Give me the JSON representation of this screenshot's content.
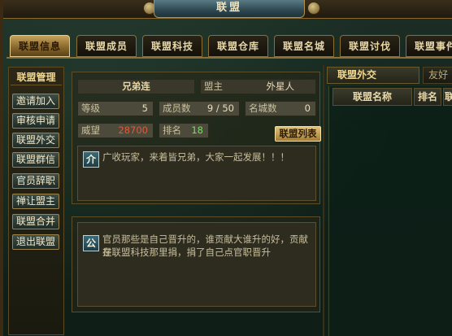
{
  "window": {
    "title": "联盟"
  },
  "tabs": [
    {
      "label": "联盟信息",
      "active": true
    },
    {
      "label": "联盟成员"
    },
    {
      "label": "联盟科技"
    },
    {
      "label": "联盟仓库"
    },
    {
      "label": "联盟名城"
    },
    {
      "label": "联盟讨伐"
    },
    {
      "label": "联盟事件"
    }
  ],
  "sidebar": {
    "title": "联盟管理",
    "buttons": [
      "邀请加入",
      "审核申请",
      "联盟外交",
      "联盟群信",
      "官员辞职",
      "禅让盟主",
      "联盟合并",
      "退出联盟"
    ]
  },
  "info": {
    "alliance_name": "兄弟连",
    "leader_label": "盟主",
    "leader_name": "外星人",
    "level_label": "等级",
    "level_value": "5",
    "members_label": "成员数",
    "members_value": "9 / 50",
    "cities_label": "名城数",
    "cities_value": "0",
    "prestige_label": "威望",
    "prestige_value": "28700",
    "rank_label": "排名",
    "rank_value": "18",
    "list_button": "联盟列表",
    "intro_badge": "介",
    "intro_text": "广收玩家，来着皆兄弟，大家一起发展！！！"
  },
  "notice": {
    "badge": "公",
    "text_line1": "官员那些是自己晋升的，谁贡献大谁升的好，贡献是",
    "text_line2": "在联盟科技那里捐，捐了自己点官职晋升"
  },
  "diplomacy": {
    "tab_active": "联盟外交",
    "tab_other": "友好",
    "col_name": "联盟名称",
    "col_rank": "排名",
    "col_extra": "联"
  },
  "colors": {
    "accent_gold": "#c7a35a",
    "prestige_red": "#e05a3a",
    "rank_green": "#7fd86a"
  }
}
